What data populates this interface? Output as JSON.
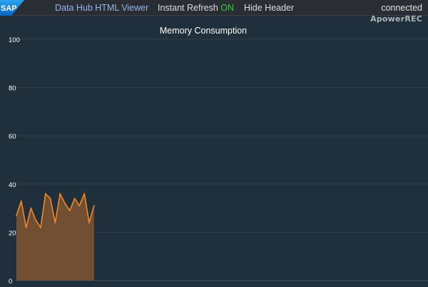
{
  "header": {
    "logo_text": "SAP",
    "viewer_label": "Data Hub HTML Viewer",
    "refresh_label": "Instant Refresh",
    "refresh_state": "ON",
    "hide_header_label": "Hide Header",
    "status": "connected",
    "watermark": "ApowerREC"
  },
  "colors": {
    "background": "#1f2f3b",
    "accent_line": "#f08a24",
    "area_fill": "#7a5232",
    "refresh_on": "#2fd12f",
    "viewer_link": "#8fb8e8"
  },
  "chart_data": {
    "type": "area",
    "title": "Memory Consumption",
    "xlabel": "",
    "ylabel": "",
    "ylim": [
      0,
      100
    ],
    "yticks": [
      0,
      20,
      40,
      60,
      80,
      100
    ],
    "grid": true,
    "series": [
      {
        "values": [
          27,
          33,
          22,
          30,
          25,
          22,
          36,
          34,
          24,
          36,
          32,
          29,
          34,
          31,
          36,
          24,
          31
        ]
      }
    ]
  }
}
